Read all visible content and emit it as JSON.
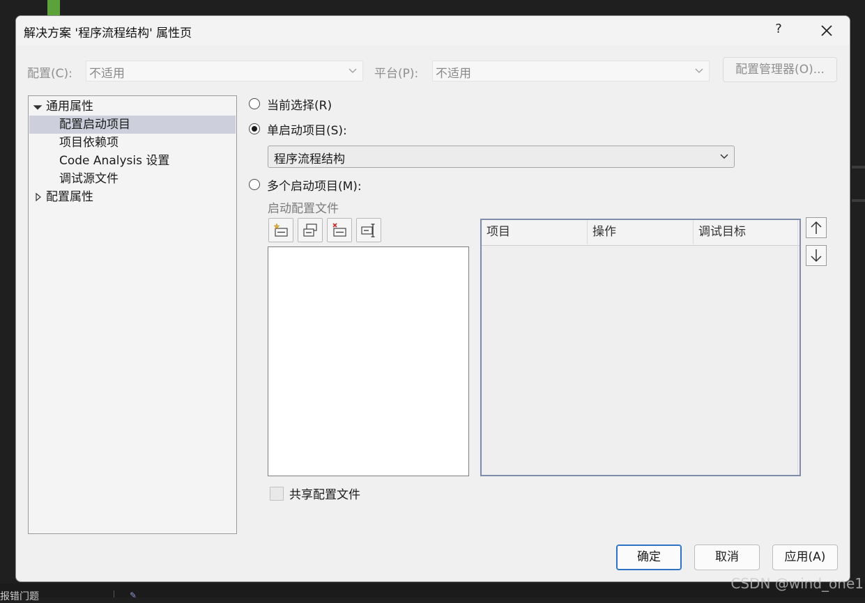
{
  "background": {
    "bottom_text": "报错门题",
    "watermark": "CSDN @wind_one1"
  },
  "dialog": {
    "title": "解决方案 '程序流程结构' 属性页",
    "help_label": "?",
    "close_icon": "close-icon"
  },
  "top_bar": {
    "config_label": "配置(C):",
    "config_value": "不适用",
    "platform_label": "平台(P):",
    "platform_value": "不适用",
    "config_manager_label": "配置管理器(O)..."
  },
  "tree": {
    "items": [
      {
        "label": "通用属性",
        "expanded": true
      },
      {
        "label": "配置启动项目",
        "selected": true
      },
      {
        "label": "项目依赖项"
      },
      {
        "label": "Code Analysis 设置"
      },
      {
        "label": "调试源文件"
      },
      {
        "label": "配置属性",
        "expanded": false
      }
    ]
  },
  "startup": {
    "current_selection_label": "当前选择(R)",
    "single_label": "单启动项目(S):",
    "single_selected": true,
    "single_value": "程序流程结构",
    "multiple_label": "多个启动项目(M):",
    "profile_label": "启动配置文件",
    "toolbar_icons": [
      "new-profile-icon",
      "copy-profile-icon",
      "delete-profile-icon",
      "rename-profile-icon"
    ],
    "grid_columns": [
      "项目",
      "操作",
      "调试目标"
    ],
    "move_up_icon": "arrow-up-icon",
    "move_down_icon": "arrow-down-icon",
    "share_label": "共享配置文件",
    "share_checked": false
  },
  "buttons": {
    "ok": "确定",
    "cancel": "取消",
    "apply": "应用(A)"
  },
  "colors": {
    "accent": "#2b72c7",
    "tree_selection": "#cdd0dc",
    "dialog_bg": "#f0f0f0"
  }
}
